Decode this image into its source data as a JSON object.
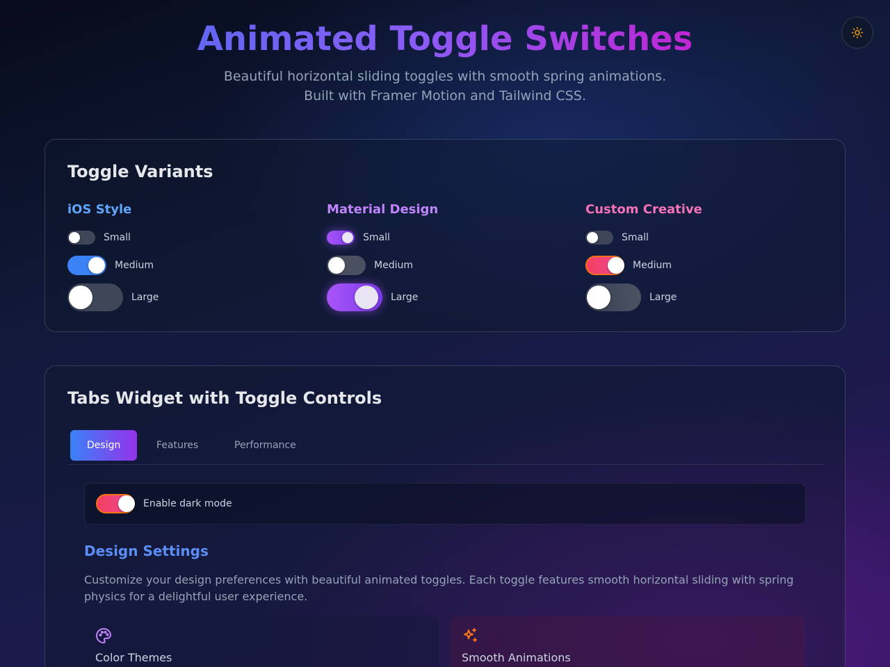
{
  "header": {
    "title": "Animated Toggle Switches",
    "subtitle_line1": "Beautiful horizontal sliding toggles with smooth spring animations.",
    "subtitle_line2": "Built with Framer Motion and Tailwind CSS."
  },
  "theme_toggle": {
    "icon": "sun-icon"
  },
  "variants_card": {
    "title": "Toggle Variants",
    "groups": [
      {
        "name": "iOS Style",
        "color": "#60a5fa",
        "toggles": [
          {
            "label": "Small",
            "on": false
          },
          {
            "label": "Medium",
            "on": true
          },
          {
            "label": "Large",
            "on": false
          }
        ]
      },
      {
        "name": "Material Design",
        "color": "#c084fc",
        "toggles": [
          {
            "label": "Small",
            "on": true
          },
          {
            "label": "Medium",
            "on": false
          },
          {
            "label": "Large",
            "on": true
          }
        ]
      },
      {
        "name": "Custom Creative",
        "color": "#f472b6",
        "toggles": [
          {
            "label": "Small",
            "on": false
          },
          {
            "label": "Medium",
            "on": true
          },
          {
            "label": "Large",
            "on": false
          }
        ]
      }
    ]
  },
  "tabs_card": {
    "title": "Tabs Widget with Toggle Controls",
    "tabs": [
      {
        "label": "Design",
        "active": true
      },
      {
        "label": "Features",
        "active": false
      },
      {
        "label": "Performance",
        "active": false
      }
    ],
    "dark_mode": {
      "label": "Enable dark mode",
      "on": true
    },
    "section_title": "Design Settings",
    "section_desc": "Customize your design preferences with beautiful animated toggles. Each toggle features smooth horizontal sliding with spring physics for a delightful user experience.",
    "features": [
      {
        "name": "Color Themes",
        "icon": "palette-icon"
      },
      {
        "name": "Smooth Animations",
        "icon": "sparkles-icon"
      }
    ]
  }
}
